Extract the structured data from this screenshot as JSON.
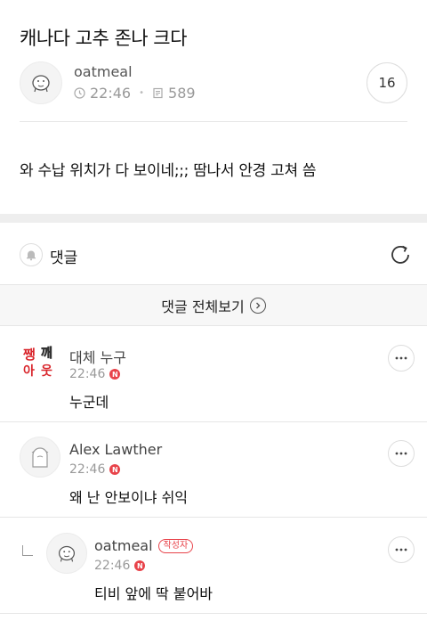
{
  "post": {
    "title": "캐나다 고추 존나 크다",
    "author": "oatmeal",
    "time": "22:46",
    "views": "589",
    "comment_count": "16",
    "body": "와 수납 위치가 다 보이네;;; 땀나서 안경 고쳐 씀"
  },
  "comments_section": {
    "label": "댓글",
    "view_all_label": "댓글 전체보기"
  },
  "comments": [
    {
      "author": "대체 누구",
      "time": "22:46",
      "new_label": "N",
      "text": "누군데",
      "avatar_text": [
        "쨍",
        "깨",
        "아",
        "웃"
      ]
    },
    {
      "author": "Alex Lawther",
      "time": "22:46",
      "new_label": "N",
      "text": "왜 난 안보이냐 쉬익"
    },
    {
      "author": "oatmeal",
      "writer_label": "작성자",
      "time": "22:46",
      "new_label": "N",
      "text": "티비 앞에 딱 붙어바",
      "is_reply": true
    }
  ],
  "colors": {
    "accent_red": "#e8434a",
    "divider": "#e6e6e6",
    "meta_gray": "#999999"
  },
  "icons": [
    "clock-icon",
    "document-icon",
    "bell-icon",
    "refresh-icon",
    "chevron-right-icon",
    "more-icon",
    "reply-arrow-icon"
  ]
}
